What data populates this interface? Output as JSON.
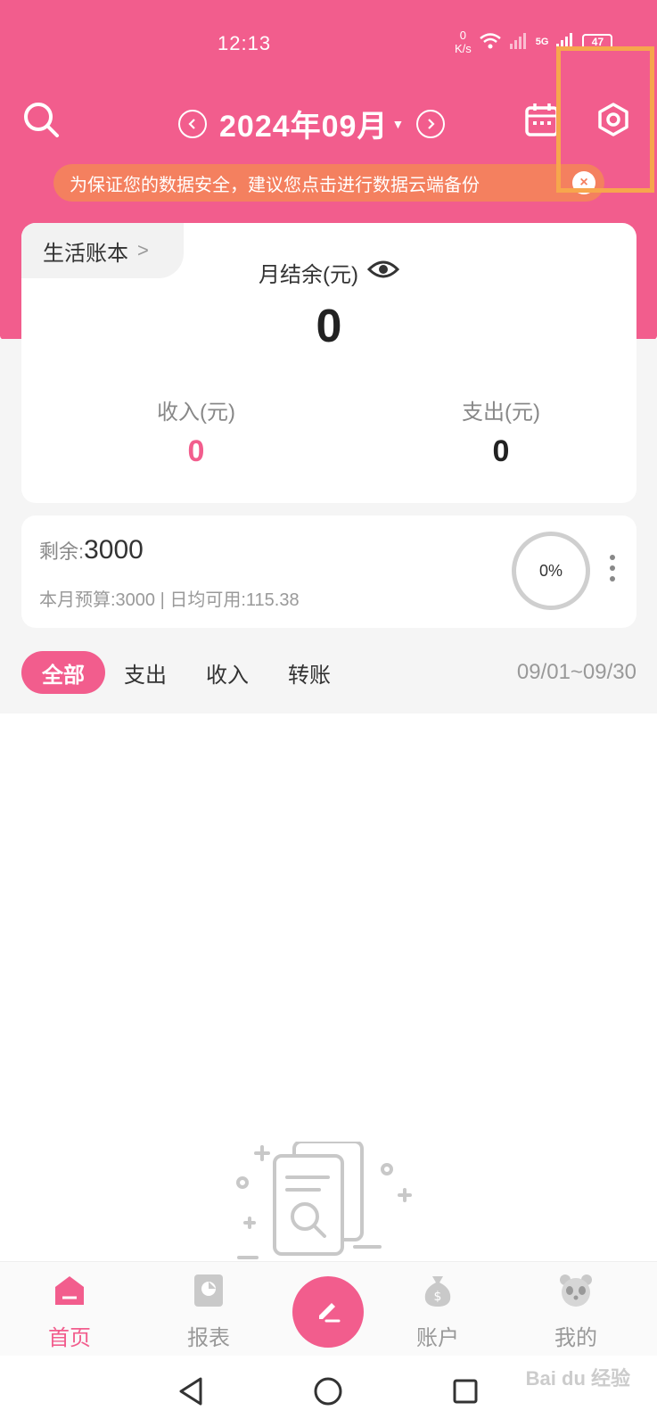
{
  "status_bar": {
    "time": "12:13",
    "net_speed_value": "0",
    "net_speed_unit": "K/s",
    "network": "5G",
    "battery": "47"
  },
  "header": {
    "month_title": "2024年09月",
    "icons": [
      "search-icon",
      "prev-month-icon",
      "next-month-icon",
      "calendar-icon",
      "settings-icon"
    ]
  },
  "notice": {
    "text": "为保证您的数据安全，建议您点击进行数据云端备份",
    "close": "×"
  },
  "summary": {
    "book_name": "生活账本",
    "book_chevron": ">",
    "balance_label": "月结余(元)",
    "balance_value": "0",
    "income_label": "收入(元)",
    "income_value": "0",
    "expense_label": "支出(元)",
    "expense_value": "0"
  },
  "budget": {
    "remain_label": "剩余:",
    "remain_value": "3000",
    "detail": "本月预算:3000 | 日均可用:115.38",
    "progress_text": "0%",
    "progress_fraction": 0
  },
  "filters": {
    "tabs": [
      "全部",
      "支出",
      "收入",
      "转账"
    ],
    "date_range": "09/01~09/30"
  },
  "bottom_nav": {
    "items": [
      "首页",
      "报表",
      "账户",
      "我的"
    ]
  },
  "watermark": "Bai du 经验",
  "colors": {
    "accent": "#f25d8d",
    "notice": "#f4805f",
    "highlight": "#f7a64d"
  }
}
